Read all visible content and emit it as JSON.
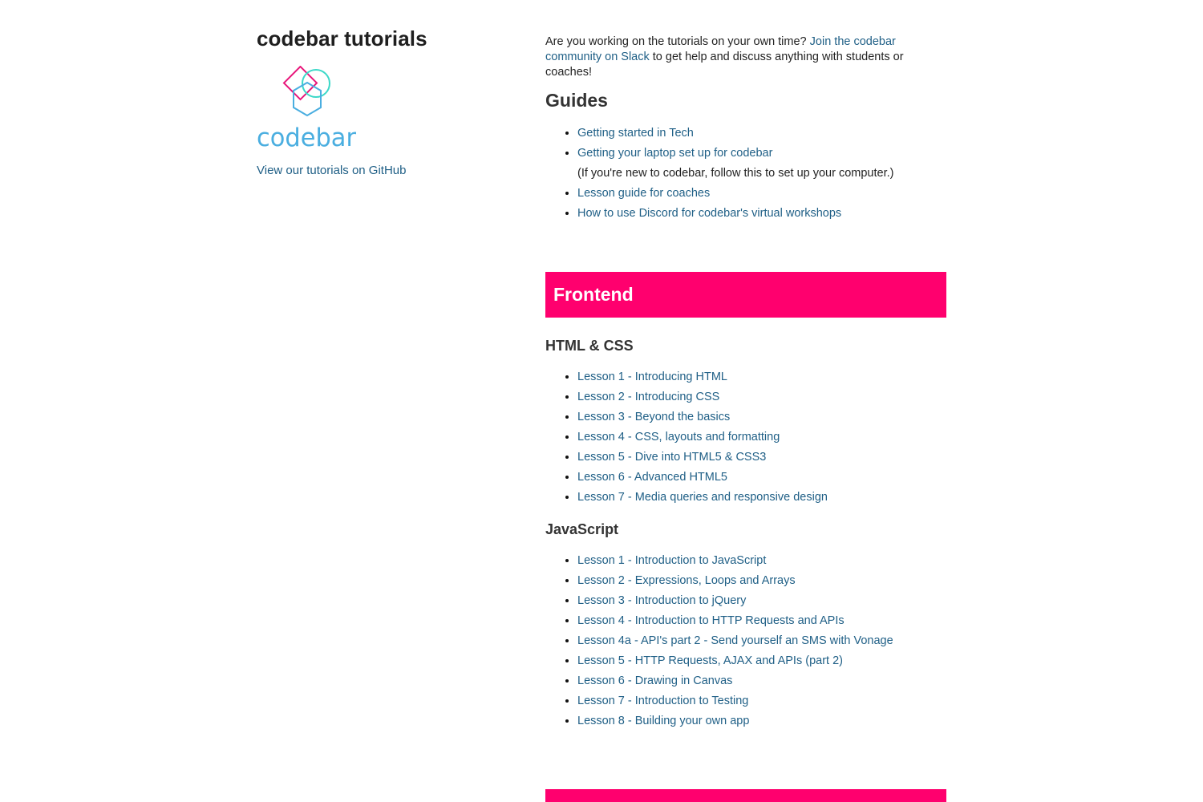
{
  "site": {
    "title": "codebar tutorials",
    "logo_text": "codebar",
    "github_link": "View our tutorials on GitHub"
  },
  "intro": {
    "text_before": "Are you working on the tutorials on your own time?",
    "link": "Join the codebar community on Slack",
    "text_after": "to get help and discuss anything with students or coaches!"
  },
  "guides": {
    "heading": "Guides",
    "items": [
      {
        "label": "Getting started in Tech"
      },
      {
        "label": "Getting your laptop set up for codebar",
        "note": "(If you're new to codebar, follow this to set up your computer.)"
      },
      {
        "label": "Lesson guide for coaches"
      },
      {
        "label": "How to use Discord for codebar's virtual workshops"
      }
    ]
  },
  "frontend": {
    "banner": "Frontend",
    "html_css": {
      "heading": "HTML & CSS",
      "items": [
        "Lesson 1 - Introducing HTML",
        "Lesson 2 - Introducing CSS",
        "Lesson 3 - Beyond the basics",
        "Lesson 4 - CSS, layouts and formatting",
        "Lesson 5 - Dive into HTML5 & CSS3",
        "Lesson 6 - Advanced HTML5",
        "Lesson 7 - Media queries and responsive design"
      ]
    },
    "javascript": {
      "heading": "JavaScript",
      "items": [
        "Lesson 1 - Introduction to JavaScript",
        "Lesson 2 - Expressions, Loops and Arrays",
        "Lesson 3 - Introduction to jQuery",
        "Lesson 4 - Introduction to HTTP Requests and APIs",
        "Lesson 4a - API's part 2 - Send yourself an SMS with Vonage",
        "Lesson 5 - HTTP Requests, AJAX and APIs (part 2)",
        "Lesson 6 - Drawing in Canvas",
        "Lesson 7 - Introduction to Testing",
        "Lesson 8 - Building your own app"
      ]
    }
  },
  "colors": {
    "accent": "#ff006e",
    "link": "#1f5f86",
    "logo_pink": "#e8157a",
    "logo_teal": "#3bd8c8",
    "logo_blue": "#4aaee0"
  }
}
